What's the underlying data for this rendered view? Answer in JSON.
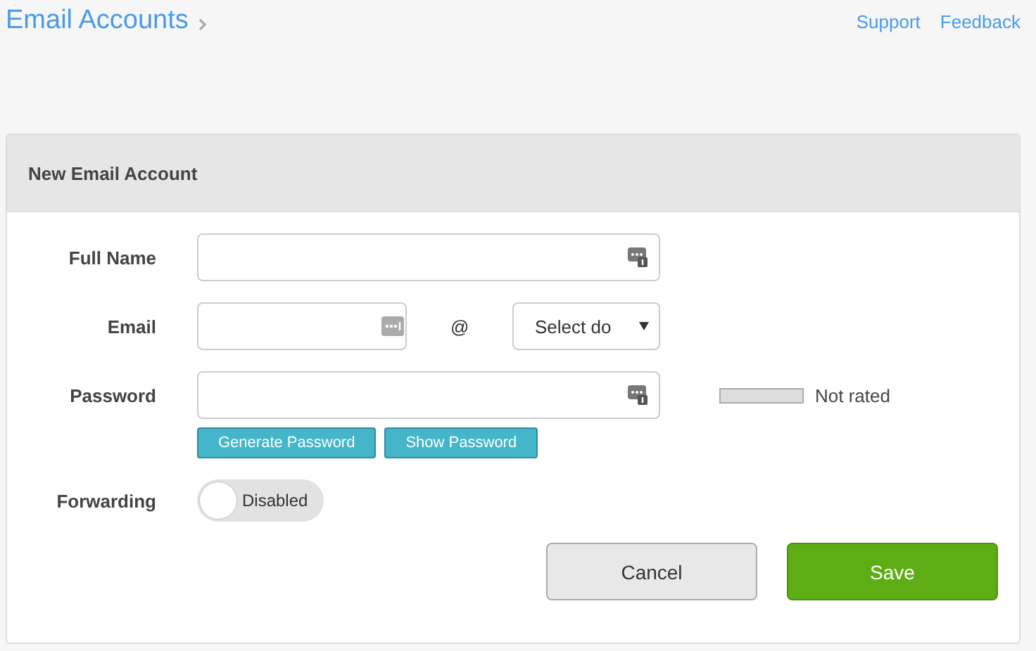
{
  "header": {
    "title": "Email Accounts",
    "links": [
      "Support",
      "Feedback"
    ]
  },
  "panel": {
    "title": "New Email Account",
    "full_name": {
      "label": "Full Name"
    },
    "email": {
      "label": "Email",
      "at": "@",
      "domain_select": "Select do"
    },
    "password": {
      "label": "Password",
      "strength": {
        "level": 0,
        "reading": "Not rated"
      },
      "buttons": [
        "Generate Password",
        "Show Password"
      ]
    },
    "forwarding": {
      "label": "Forwarding",
      "on": false,
      "state_label": "Disabled"
    },
    "actions": [
      {
        "label": "Cancel",
        "kind": "secondary"
      },
      {
        "label": "Save",
        "kind": "primary"
      }
    ]
  }
}
